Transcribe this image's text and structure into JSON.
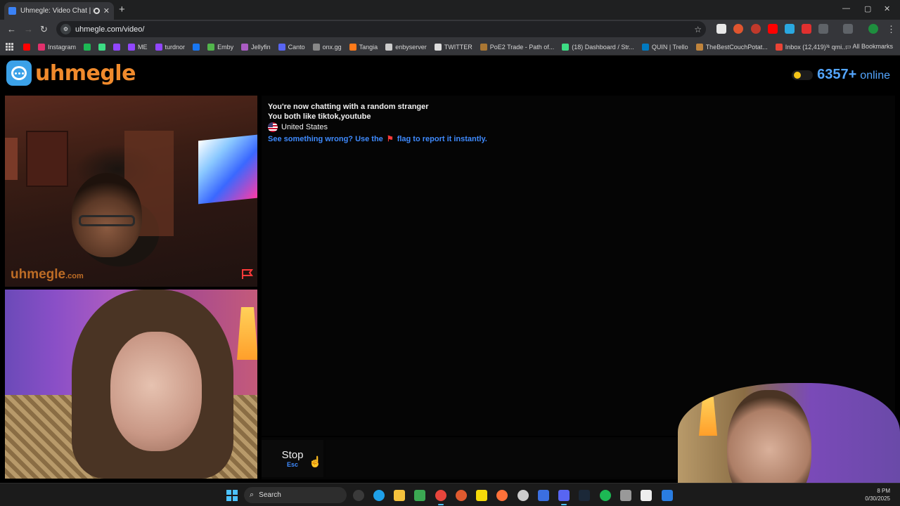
{
  "browser": {
    "tab_title": "Uhmegle: Video Chat | Rand",
    "tab_close": "✕",
    "new_tab": "+",
    "url": "uhmegle.com/video/",
    "window_controls": {
      "minimize": "—",
      "maximize": "▢",
      "close": "✕"
    },
    "bookmarks": [
      {
        "label": "",
        "color": "#ff0000"
      },
      {
        "label": "Instagram",
        "color": "#e1306c"
      },
      {
        "label": "",
        "color": "#1db954"
      },
      {
        "label": "",
        "color": "#3ddc84"
      },
      {
        "label": "",
        "color": "#9146ff"
      },
      {
        "label": "ME",
        "color": "#9146ff"
      },
      {
        "label": "turdnor",
        "color": "#9146ff"
      },
      {
        "label": "",
        "color": "#1877f2"
      },
      {
        "label": "Emby",
        "color": "#52b54b"
      },
      {
        "label": "Jellyfin",
        "color": "#aa5cc3"
      },
      {
        "label": "Canto",
        "color": "#5865f2"
      },
      {
        "label": "onx.gg",
        "color": "#888888"
      },
      {
        "label": "Tangia",
        "color": "#ff7a1a"
      },
      {
        "label": "enbyserver",
        "color": "#cccccc"
      },
      {
        "label": "TWITTER",
        "color": "#dddddd"
      },
      {
        "label": "PoE2 Trade - Path of...",
        "color": "#aa7733"
      },
      {
        "label": "(18) Dashboard / Str...",
        "color": "#3ddc84"
      },
      {
        "label": "QUIN | Trello",
        "color": "#0079bf"
      },
      {
        "label": "TheBestCouchPotat...",
        "color": "#c0843c"
      },
      {
        "label": "Inbox (12,419) - qmi...",
        "color": "#ea4335"
      }
    ],
    "overflow_chevron": "»",
    "all_bookmarks": "All Bookmarks"
  },
  "site": {
    "logo_text": "uhmegle",
    "online_count": "6357+",
    "online_label": "online",
    "watermark": "uhmegle",
    "watermark_suffix": ".com"
  },
  "chat": {
    "line1": "You're now chatting with a random stranger",
    "line2": "You both like tiktok,youtube",
    "country": "United States",
    "report_before": "See something wrong? Use the",
    "report_after": "flag to report it instantly."
  },
  "controls": {
    "stop_label": "Stop",
    "stop_hint": "Esc"
  },
  "taskbar": {
    "search_label": "Search",
    "time": "8 PM",
    "date": "0/30/2025"
  }
}
